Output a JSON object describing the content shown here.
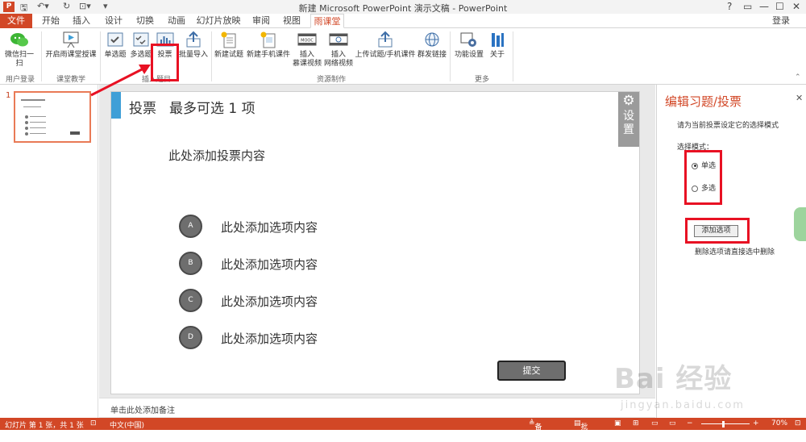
{
  "titlebar": {
    "app_icon": "P",
    "title": "新建 Microsoft PowerPoint 演示文稿 - PowerPoint",
    "help": "?",
    "controls": [
      "▭",
      "—",
      "☐",
      "✕"
    ]
  },
  "tabs": {
    "items": [
      "文件",
      "开始",
      "插入",
      "设计",
      "切换",
      "动画",
      "幻灯片放映",
      "审阅",
      "视图",
      "雨课堂"
    ],
    "active": "雨课堂",
    "login": "登录"
  },
  "ribbon": {
    "buttons": {
      "wechat_scan": "微信扫一扫",
      "open_class": "开启雨课堂授课",
      "single_choice": "单选题",
      "multi_choice": "多选题",
      "vote": "投票",
      "batch_import": "批量导入",
      "new_quiz": "新建试题",
      "new_mobile": "新建手机课件",
      "insert_mooc_1": "插入",
      "insert_mooc_2": "慕课视频",
      "insert_web_1": "插入",
      "insert_web_2": "网络视频",
      "upload": "上传试题/手机课件",
      "share": "群发链接",
      "settings": "功能设置",
      "about": "关于"
    },
    "groups": {
      "user_login": "用户登录",
      "teaching": "课堂教学",
      "insert_quiz": "插入题目",
      "resources": "资源制作",
      "more": "更多"
    }
  },
  "thumbnail": {
    "number": "1"
  },
  "slide": {
    "vote_title": "投票",
    "subtitle": "最多可选 1 项",
    "content_placeholder": "此处添加投票内容",
    "settings_label_1": "设",
    "settings_label_2": "置",
    "options": [
      {
        "letter": "A",
        "text": "此处添加选项内容"
      },
      {
        "letter": "B",
        "text": "此处添加选项内容"
      },
      {
        "letter": "C",
        "text": "此处添加选项内容"
      },
      {
        "letter": "D",
        "text": "此处添加选项内容"
      }
    ],
    "submit": "提交"
  },
  "notes": {
    "placeholder": "单击此处添加备注"
  },
  "taskpane": {
    "header": "编辑习题/投票",
    "close": "✕",
    "instruction": "请为当前投票设定它的选择模式",
    "mode_label": "选择模式：",
    "single": "单选",
    "multi": "多选",
    "selected_mode": "单选",
    "add_option": "添加选项",
    "delete_hint": "删除选项请直接选中删除"
  },
  "statusbar": {
    "slide_info": "幻灯片 第 1 张，共 1 张",
    "language": "中文(中国)",
    "notes": "备注",
    "comments": "批注",
    "zoom": "70%"
  },
  "watermark": {
    "text": "Bai 经验",
    "url": "jingyan.baidu.com"
  },
  "colors": {
    "accent": "#d24726",
    "highlight": "#e81123",
    "slide_accent": "#3f9fd7",
    "option_fill": "#6e6e6e"
  }
}
